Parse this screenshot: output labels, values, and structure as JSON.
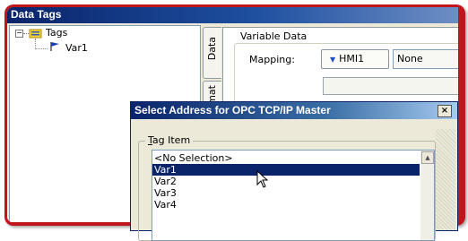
{
  "window": {
    "title": "Data Tags"
  },
  "tree": {
    "root_label": "Tags",
    "child_label": "Var1"
  },
  "tabs": {
    "data": "Data",
    "format": "mat"
  },
  "variable_data": {
    "group_label": "Variable Data",
    "mapping_label": "Mapping:",
    "hmi_button_label": "HMI1",
    "mapping_value": "None"
  },
  "dialog": {
    "title": "Select Address for OPC TCP/IP Master",
    "close_label": "×",
    "group_label_key": "T",
    "group_label_rest": "ag Item",
    "items": [
      "<No Selection>",
      "Var1",
      "Var2",
      "Var3",
      "Var4"
    ],
    "selected_index": 1
  },
  "colors": {
    "frame_red": "#c0151a",
    "title_blue": "#0a246a",
    "selection": "#0a246a"
  }
}
